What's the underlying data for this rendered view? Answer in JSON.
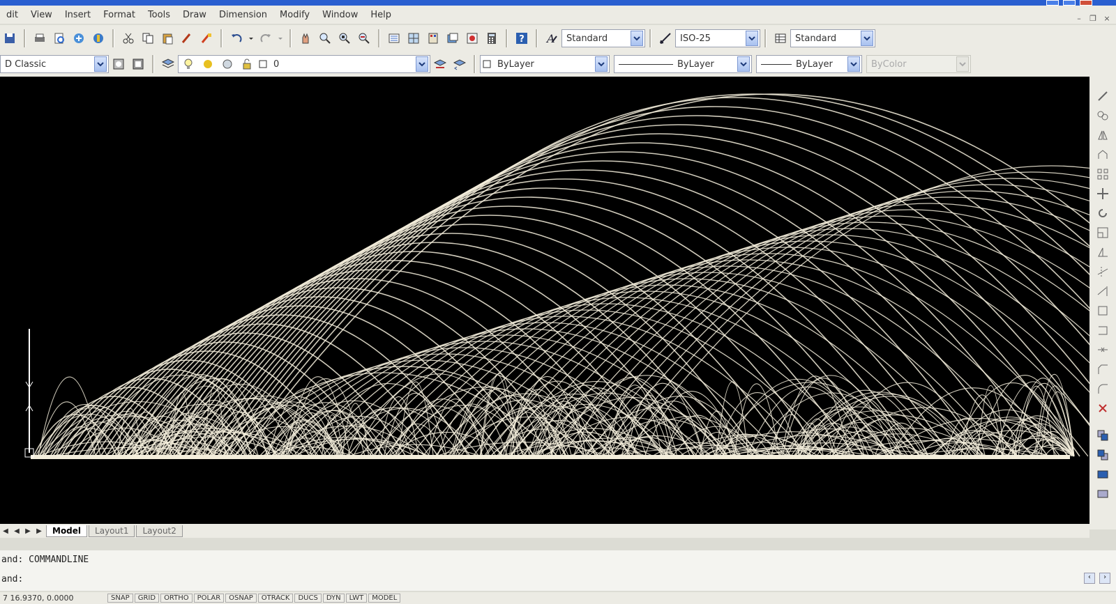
{
  "menu": [
    "dit",
    "View",
    "Insert",
    "Format",
    "Tools",
    "Draw",
    "Dimension",
    "Modify",
    "Window",
    "Help"
  ],
  "styles": {
    "text_style": "Standard",
    "dim_style": "ISO-25",
    "table_style": "Standard"
  },
  "workspace": "D Classic",
  "layer": {
    "name": "0"
  },
  "properties": {
    "color": "ByLayer",
    "linetype": "ByLayer",
    "lineweight": "ByLayer",
    "plotstyle": "ByColor"
  },
  "tabs": [
    "Model",
    "Layout1",
    "Layout2"
  ],
  "command": {
    "line1": "and:  COMMANDLINE",
    "line2": "and:"
  },
  "status": {
    "coords": "7  16.9370, 0.0000",
    "buttons": [
      "SNAP",
      "GRID",
      "ORTHO",
      "POLAR",
      "OSNAP",
      "OTRACK",
      "DUCS",
      "DYN",
      "LWT",
      "MODEL"
    ]
  },
  "colors": {
    "canvas": "#000000",
    "lines": "#f4eedc",
    "accent": "#2a5fd0"
  }
}
